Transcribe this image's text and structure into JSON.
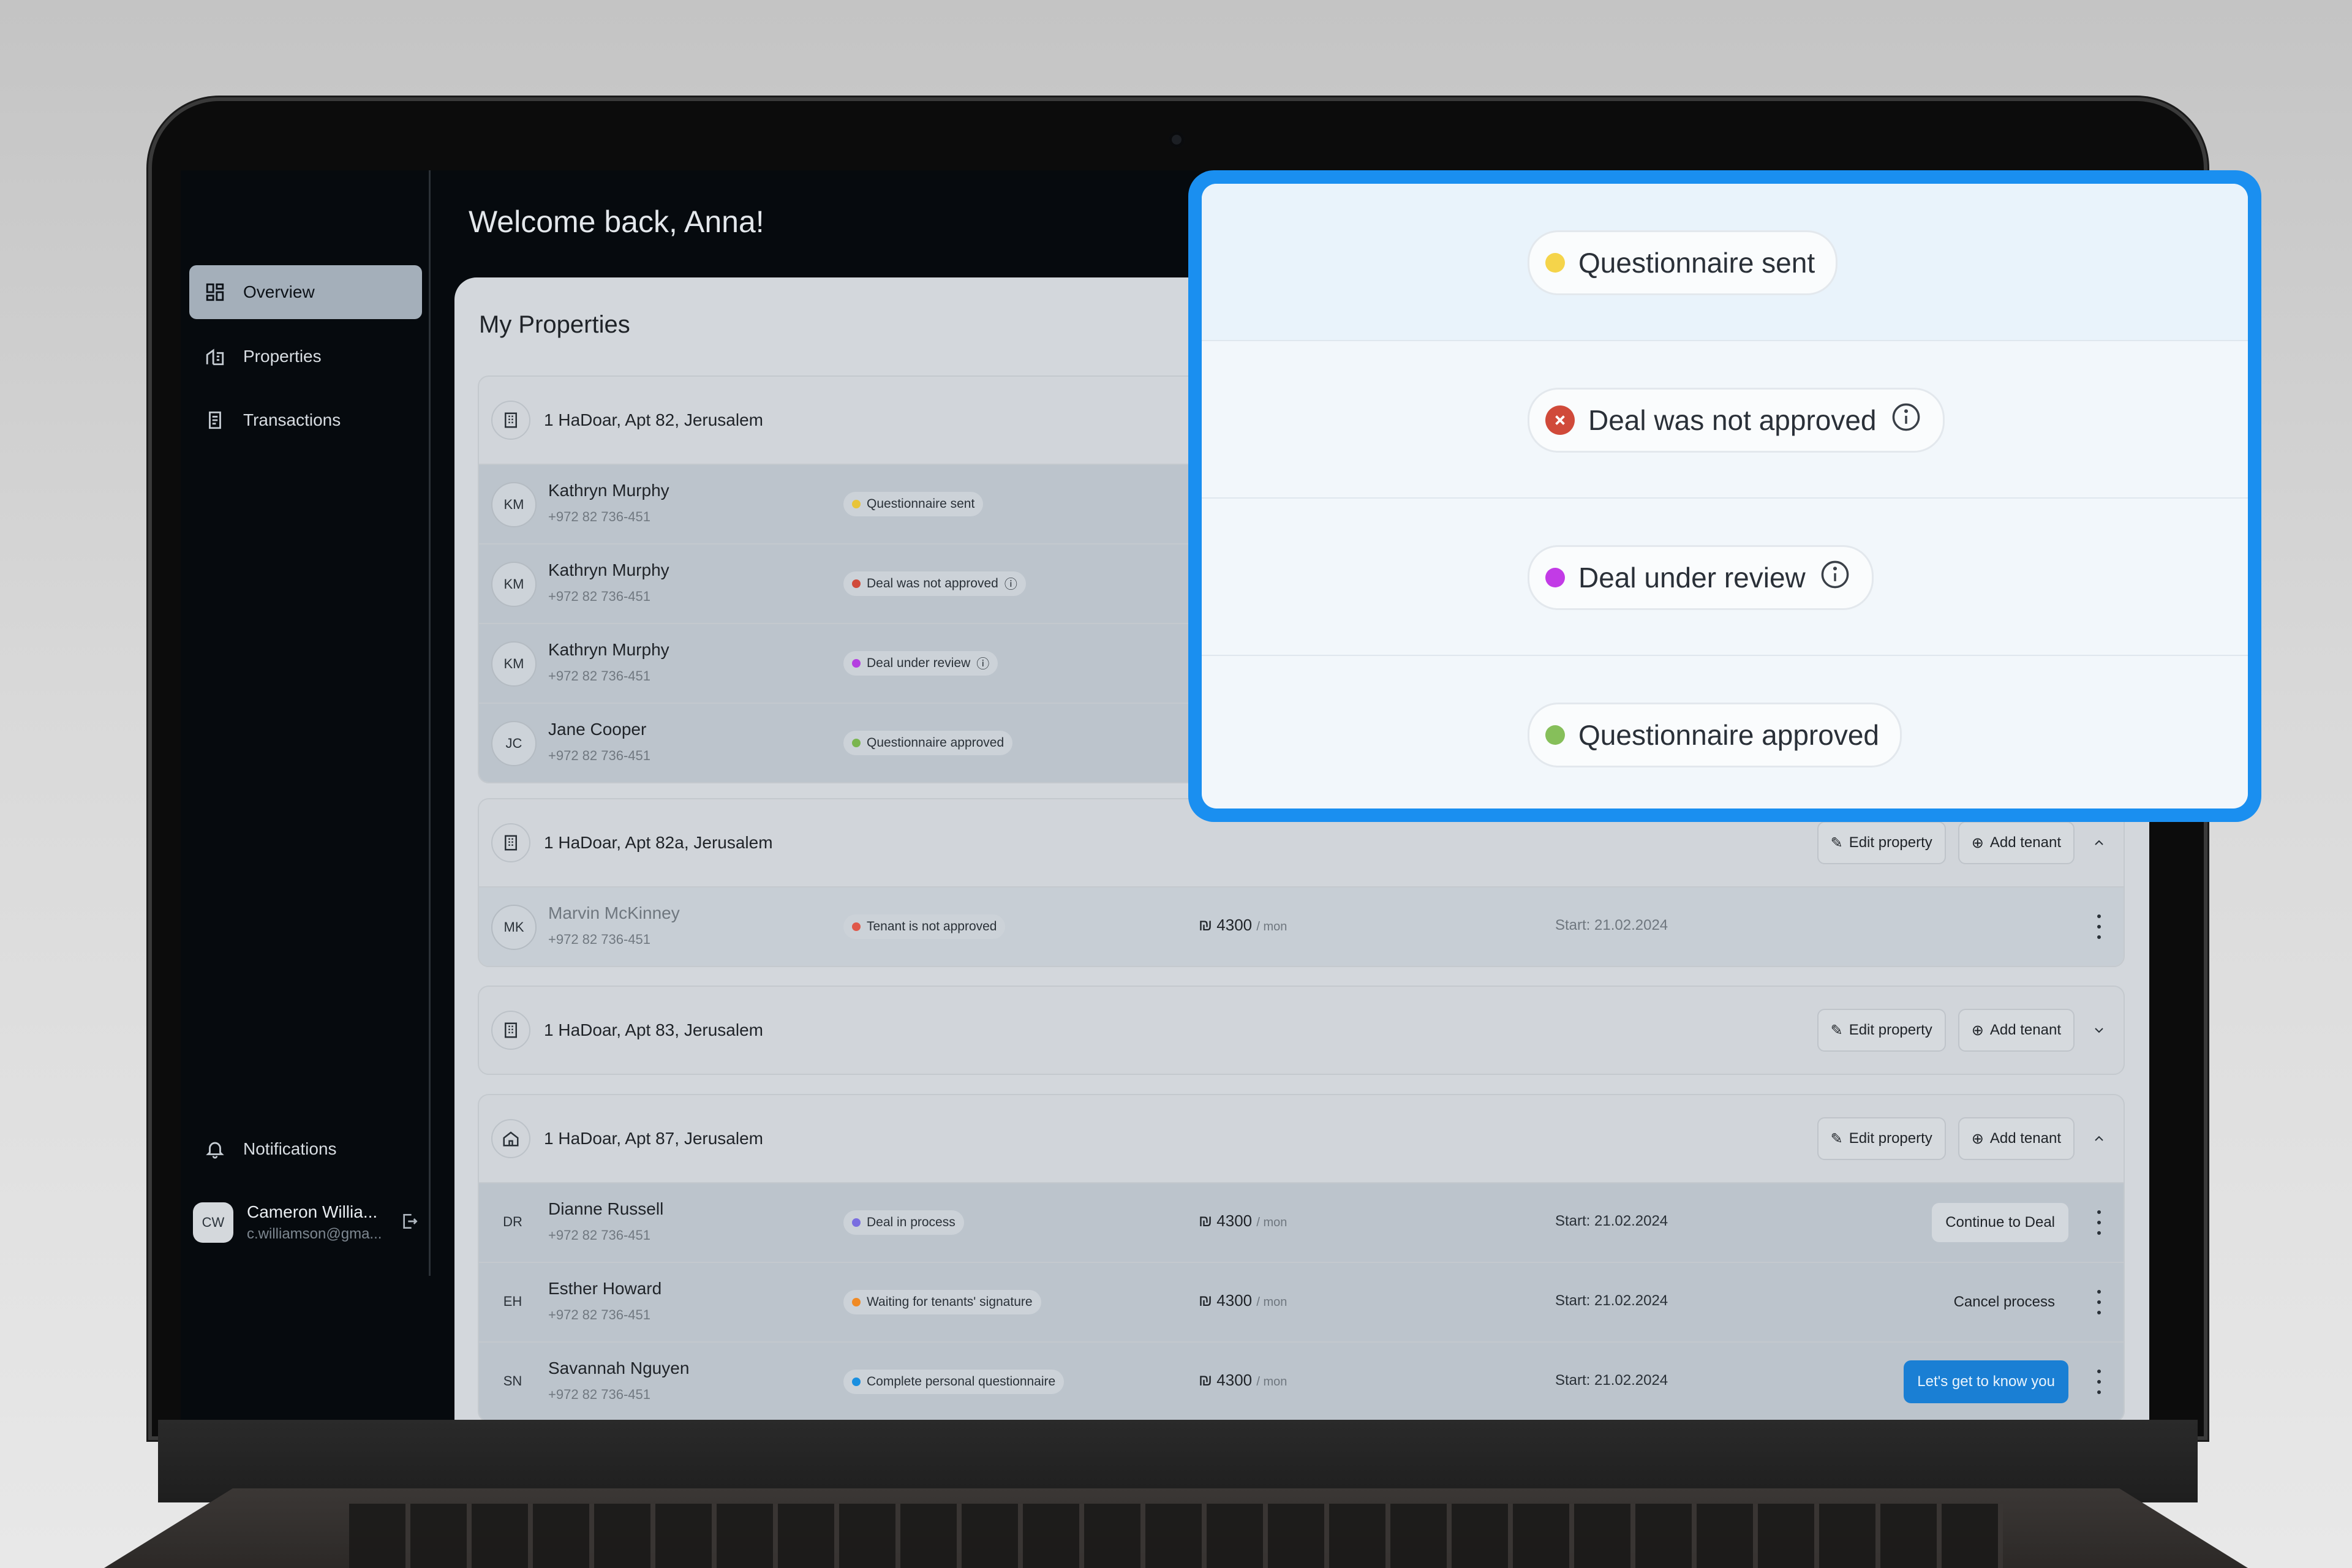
{
  "app": {
    "welcome": "Welcome back, Anna!",
    "section_title": "My Properties"
  },
  "sidebar": {
    "items": [
      {
        "label": "Overview",
        "icon": "grid-icon",
        "active": true
      },
      {
        "label": "Properties",
        "icon": "building-icon",
        "active": false
      },
      {
        "label": "Transactions",
        "icon": "receipt-icon",
        "active": false
      }
    ],
    "notifications_label": "Notifications",
    "user": {
      "initials": "CW",
      "name": "Cameron Willia...",
      "email": "c.williamson@gma..."
    }
  },
  "actions": {
    "edit_property": "Edit property",
    "add_tenant": "Add tenant"
  },
  "properties": [
    {
      "address": "1 HaDoar, Apt 82, Jerusalem",
      "tenants": [
        {
          "initials": "KM",
          "name": "Kathryn Murphy",
          "phone": "+972 82 736-451",
          "status": "Questionnaire sent",
          "status_color": "#e8c43a"
        },
        {
          "initials": "KM",
          "name": "Kathryn Murphy",
          "phone": "+972 82 736-451",
          "status": "Deal was not approved",
          "status_color": "#d04a3a"
        },
        {
          "initials": "KM",
          "name": "Kathryn Murphy",
          "phone": "+972 82 736-451",
          "status": "Deal under review",
          "status_color": "#b43ee0"
        },
        {
          "initials": "JC",
          "name": "Jane Cooper",
          "phone": "+972 82 736-451",
          "status": "Questionnaire approved",
          "status_color": "#7ab54f"
        }
      ]
    },
    {
      "address": "1 HaDoar, Apt 82a, Jerusalem",
      "tenants": [
        {
          "initials": "MK",
          "name": "Marvin McKinney",
          "phone": "+972 82 736-451",
          "status": "Tenant is not approved",
          "status_color": "#e0584a",
          "price": "₪ 4300",
          "unit": "/ mon",
          "start": "Start: 21.02.2024"
        }
      ]
    },
    {
      "address": "1 HaDoar, Apt 83, Jerusalem",
      "tenants": []
    },
    {
      "address": "1 HaDoar, Apt 87, Jerusalem",
      "tenants": [
        {
          "initials": "DR",
          "name": "Dianne Russell",
          "phone": "+972 82 736-451",
          "status": "Deal in process",
          "status_color": "#7a6ee0",
          "price": "₪ 4300",
          "unit": "/ mon",
          "start": "Start: 21.02.2024",
          "action": "Continue to Deal"
        },
        {
          "initials": "EH",
          "name": "Esther Howard",
          "phone": "+972 82 736-451",
          "status": "Waiting for tenants' signature",
          "status_color": "#f08a24",
          "price": "₪ 4300",
          "unit": "/ mon",
          "start": "Start: 21.02.2024",
          "action": "Cancel process"
        },
        {
          "initials": "SN",
          "name": "Savannah Nguyen",
          "phone": "+972 82 736-451",
          "status": "Complete personal questionnaire",
          "status_color": "#1a8fe0",
          "price": "₪ 4300",
          "unit": "/ mon",
          "start": "Start: 21.02.2024",
          "action": "Let's get to know you"
        }
      ]
    }
  ],
  "callout": {
    "badges": [
      {
        "label": "Questionnaire sent",
        "color": "#f5d44a"
      },
      {
        "label": "Deal was not approved",
        "color": "#d04a3a"
      },
      {
        "label": "Deal under review",
        "color": "#c23be6"
      },
      {
        "label": "Questionnaire approved",
        "color": "#86bf5a"
      }
    ]
  }
}
